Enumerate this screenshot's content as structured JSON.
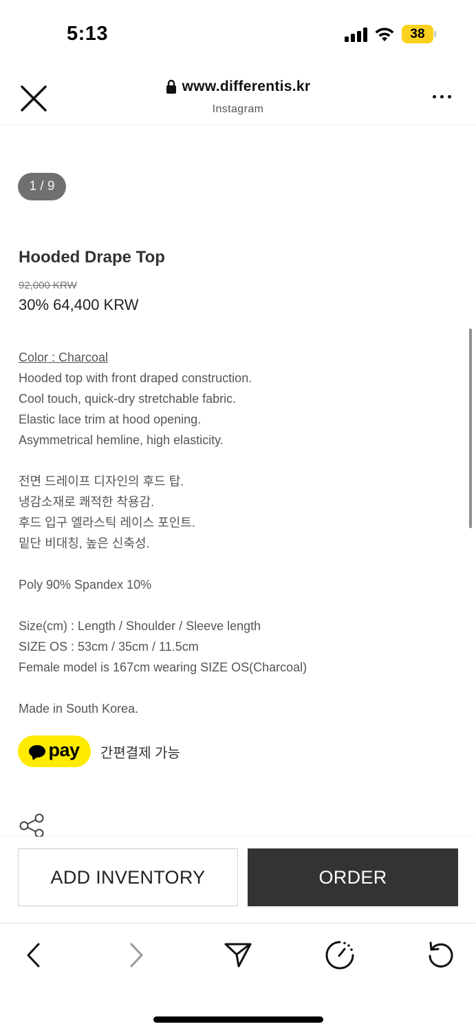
{
  "status_bar": {
    "time": "5:13",
    "battery": "38",
    "icons": [
      "signal-icon",
      "wifi-icon",
      "battery-icon"
    ]
  },
  "browser": {
    "url": "www.differentis.kr",
    "subtitle": "Instagram",
    "icons": [
      "close-icon",
      "lock-icon",
      "more-icon"
    ]
  },
  "gallery": {
    "counter": "1 / 9"
  },
  "product": {
    "title": "Hooded Drape Top",
    "original_price": "92,000 KRW",
    "sale_price": "30% 64,400 KRW",
    "color_label": "Color : Charcoal",
    "description_en": [
      "Hooded top with front draped construction.",
      "Cool touch, quick-dry stretchable fabric.",
      "Elastic lace trim at hood opening.",
      "Asymmetrical hemline, high elasticity."
    ],
    "description_ko": [
      "전면 드레이프 디자인의 후드 탑.",
      "냉감소재로 쾌적한 착용감.",
      "후드 입구 엘라스틱 레이스 포인트.",
      "밑단 비대칭, 높은 신축성."
    ],
    "material": "Poly 90% Spandex 10%",
    "size_lines": [
      "Size(cm) : Length / Shoulder / Sleeve length",
      "SIZE OS : 53cm / 35cm / 11.5cm",
      "Female model is 167cm wearing SIZE OS(Charcoal)"
    ],
    "origin": "Made in South Korea."
  },
  "kakao_pay": {
    "badge_text": "pay",
    "caption": "간편결제 가능",
    "brand_color": "#ffeb00"
  },
  "actions": {
    "add_inventory": "ADD INVENTORY",
    "order": "ORDER",
    "order_bg": "#333333"
  },
  "toolbar": {
    "icons": [
      "back-icon",
      "forward-icon",
      "send-icon",
      "speed-icon",
      "refresh-icon"
    ]
  }
}
